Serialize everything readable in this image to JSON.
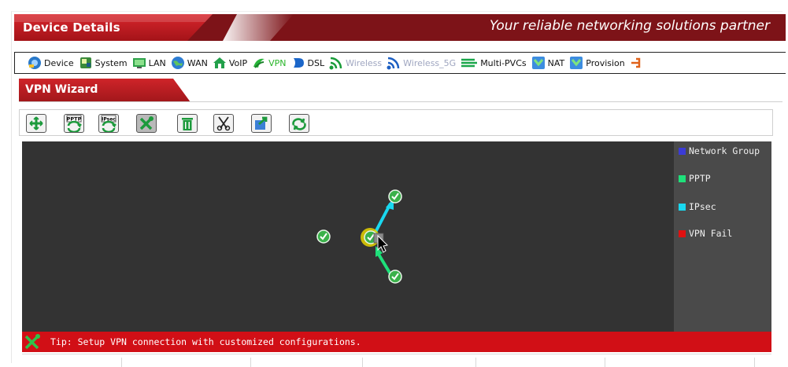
{
  "header": {
    "title": "Device Details",
    "slogan": "Your reliable networking solutions partner"
  },
  "nav": {
    "items": [
      {
        "label": "Device",
        "icon": "device-icon",
        "state": "normal"
      },
      {
        "label": "System",
        "icon": "system-icon",
        "state": "normal"
      },
      {
        "label": "LAN",
        "icon": "lan-icon",
        "state": "normal"
      },
      {
        "label": "WAN",
        "icon": "wan-globe-icon",
        "state": "normal"
      },
      {
        "label": "VoIP",
        "icon": "voip-phone-icon",
        "state": "normal"
      },
      {
        "label": "VPN",
        "icon": "vpn-icon",
        "state": "active"
      },
      {
        "label": "DSL",
        "icon": "dsl-icon",
        "state": "normal"
      },
      {
        "label": "Wireless",
        "icon": "wireless-icon",
        "state": "disabled"
      },
      {
        "label": "Wireless_5G",
        "icon": "wireless-5g-icon",
        "state": "disabled"
      },
      {
        "label": "Multi-PVCs",
        "icon": "multi-pvcs-icon",
        "state": "normal"
      },
      {
        "label": "NAT",
        "icon": "nat-icon",
        "state": "normal"
      },
      {
        "label": "Provision",
        "icon": "provision-icon",
        "state": "normal"
      },
      {
        "label": "",
        "icon": "network-icon",
        "state": "normal"
      }
    ]
  },
  "wizard": {
    "title": "VPN Wizard"
  },
  "toolbar": {
    "buttons": [
      {
        "name": "move-button",
        "icon": "move-arrows-icon",
        "text": ""
      },
      {
        "name": "pptp-button",
        "icon": "pptp-icon",
        "text": "PPTP"
      },
      {
        "name": "ipsec-button",
        "icon": "ipsec-icon",
        "text": "IPsec"
      },
      {
        "name": "configure-button",
        "icon": "tools-icon",
        "text": ""
      },
      {
        "name": "delete-button",
        "icon": "trash-icon",
        "text": ""
      },
      {
        "name": "cut-button",
        "icon": "scissors-icon",
        "text": ""
      },
      {
        "name": "export-button",
        "icon": "export-icon",
        "text": ""
      },
      {
        "name": "refresh-button",
        "icon": "refresh-icon",
        "text": ""
      }
    ]
  },
  "legend": {
    "items": [
      {
        "label": "Network Group",
        "color": "#3b3bd6"
      },
      {
        "label": "PPTP",
        "color": "#1ee07a"
      },
      {
        "label": "IPsec",
        "color": "#19d8f0"
      },
      {
        "label": "VPN Fail",
        "color": "#e01010"
      }
    ]
  },
  "tip": {
    "text": "Tip: Setup VPN connection with customized configurations."
  },
  "colors": {
    "header_red": "#c8161d",
    "header_dark": "#7d1318",
    "canvas_bg": "#333333",
    "legend_bg": "#4a4a4a",
    "tip_red": "#d10f16",
    "nav_active": "#2ab62a",
    "node_green": "#3ab14a",
    "link_ipsec": "#19d8f0",
    "link_pptp": "#1ee07a"
  }
}
